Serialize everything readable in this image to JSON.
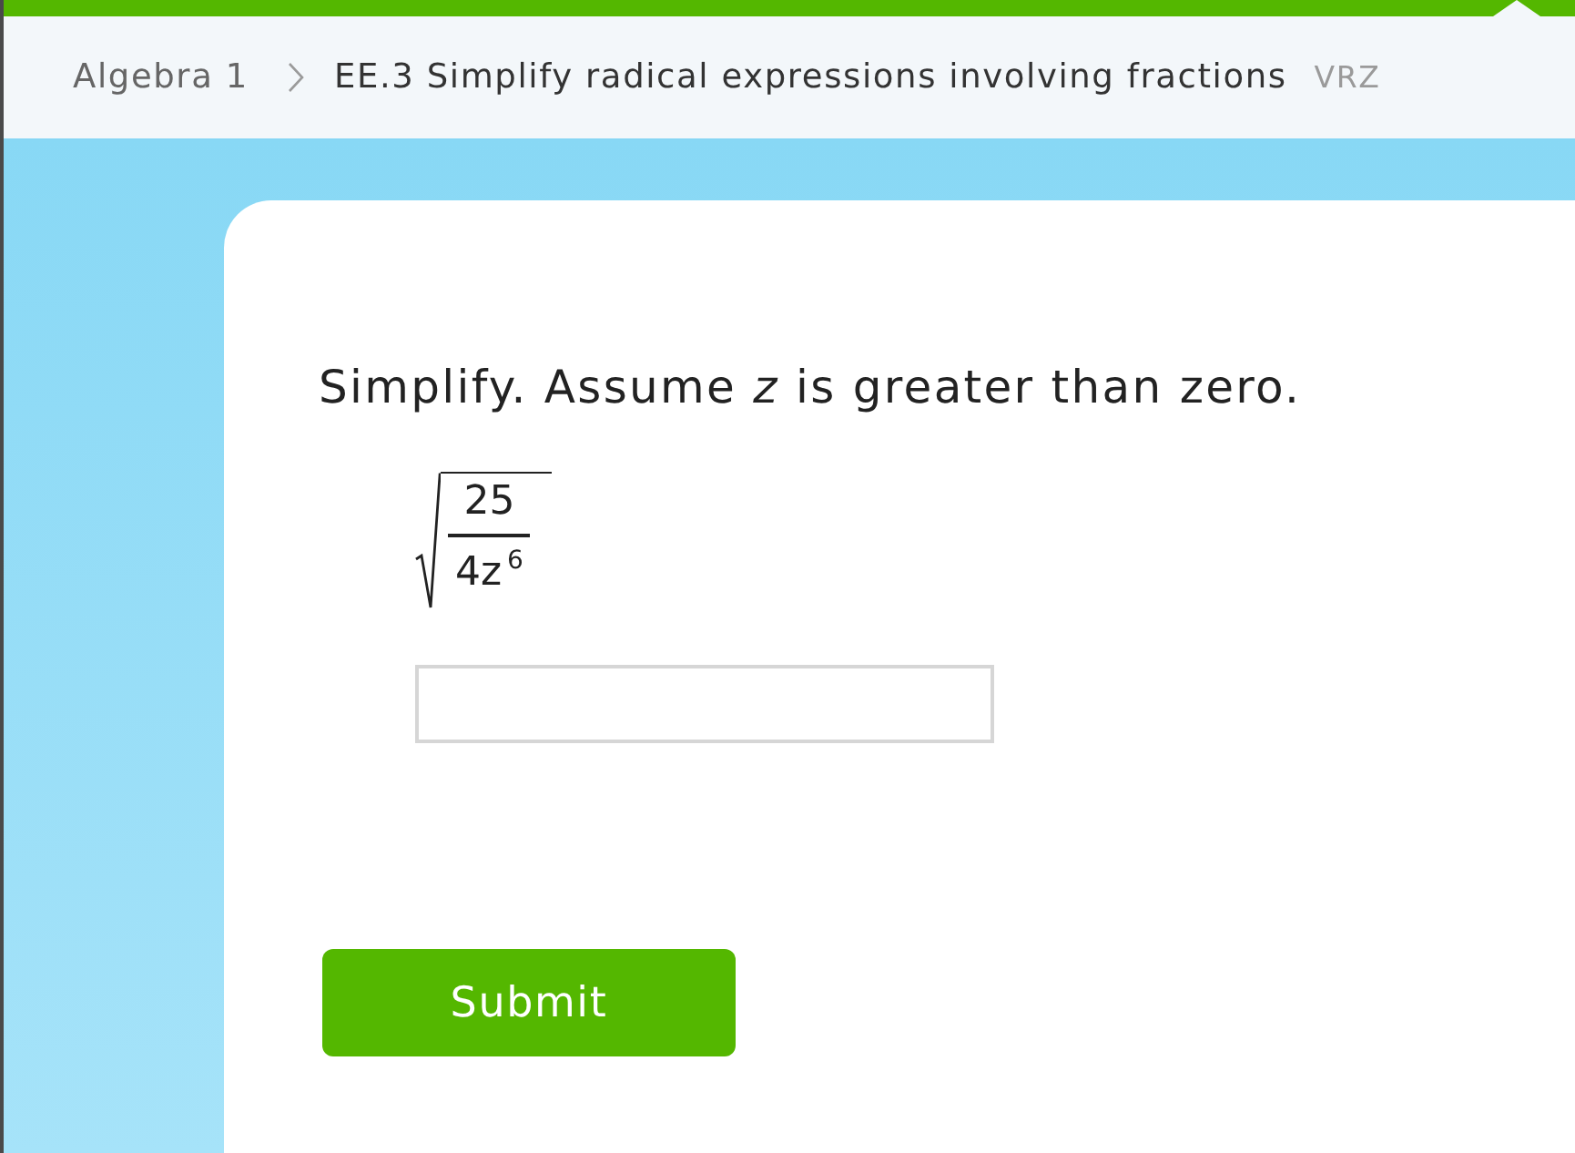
{
  "breadcrumb": {
    "items": [
      {
        "label": "Algebra 1",
        "current": false
      },
      {
        "label": "EE.3 Simplify radical expressions involving fractions",
        "current": true
      }
    ],
    "code": "VRZ"
  },
  "question": {
    "prompt": "Simplify. Assume *z* is greater than zero.",
    "expression": {
      "kind": "sqrt_fraction",
      "numerator": "25",
      "denominator": "4z$^{6}$"
    },
    "answer": {
      "kind": "text_input"
    }
  },
  "buttons": [
    {
      "label": "Submit"
    }
  ]
}
